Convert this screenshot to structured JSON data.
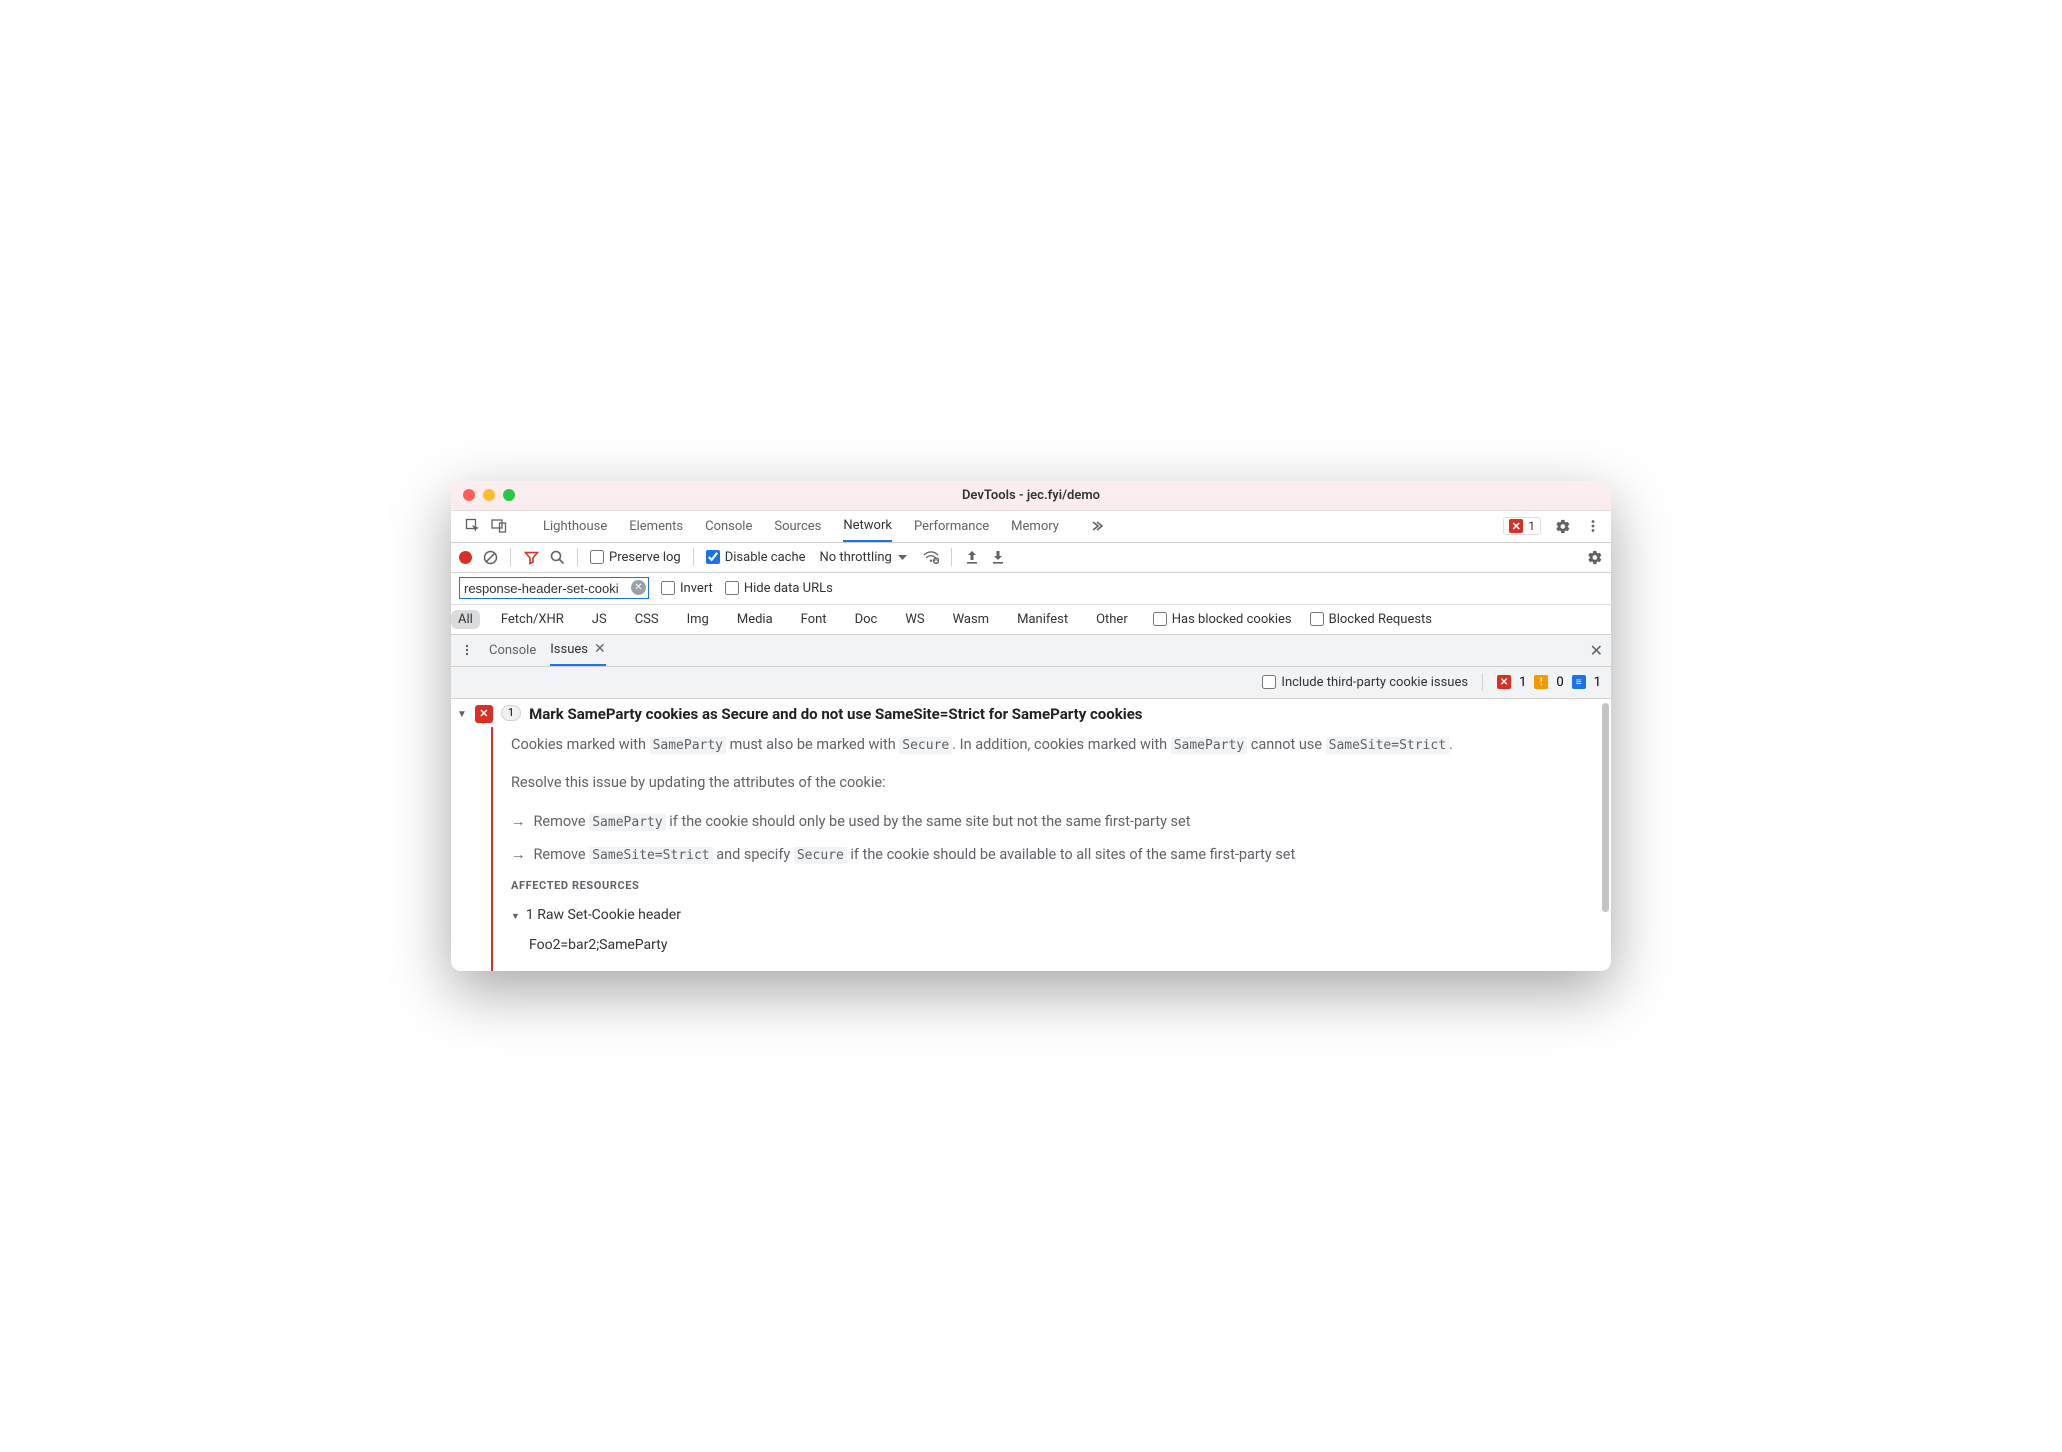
{
  "window": {
    "title": "DevTools - jec.fyi/demo"
  },
  "mainTabs": {
    "items": [
      "Lighthouse",
      "Elements",
      "Console",
      "Sources",
      "Network",
      "Performance",
      "Memory"
    ],
    "active": "Network",
    "errorCount": "1"
  },
  "toolbar": {
    "preserveLog": {
      "label": "Preserve log",
      "checked": false
    },
    "disableCache": {
      "label": "Disable cache",
      "checked": true
    },
    "throttling": "No throttling"
  },
  "filter": {
    "value": "response-header-set-cooki",
    "invert": {
      "label": "Invert",
      "checked": false
    },
    "hideDataUrls": {
      "label": "Hide data URLs",
      "checked": false
    }
  },
  "types": {
    "items": [
      "All",
      "Fetch/XHR",
      "JS",
      "CSS",
      "Img",
      "Media",
      "Font",
      "Doc",
      "WS",
      "Wasm",
      "Manifest",
      "Other"
    ],
    "active": "All",
    "blockedCookies": {
      "label": "Has blocked cookies",
      "checked": false
    },
    "blockedRequests": {
      "label": "Blocked Requests",
      "checked": false
    }
  },
  "drawer": {
    "tabs": {
      "items": [
        "Console",
        "Issues"
      ],
      "active": "Issues"
    }
  },
  "issuesHeader": {
    "includeThirdParty": {
      "label": "Include third-party cookie issues",
      "checked": false
    },
    "counts": {
      "error": "1",
      "warn": "0",
      "info": "1"
    }
  },
  "issue": {
    "count": "1",
    "title": "Mark SameParty cookies as Secure and do not use SameSite=Strict for SameParty cookies",
    "para1_a": "Cookies marked with ",
    "para1_b": " must also be marked with ",
    "para1_c": ". In addition, cookies marked with ",
    "para1_d": " cannot use ",
    "para1_e": ".",
    "code_sameparty": "SameParty",
    "code_secure": "Secure",
    "code_samesite": "SameSite=Strict",
    "para2": "Resolve this issue by updating the attributes of the cookie:",
    "bullet1_a": "Remove ",
    "bullet1_b": " if the cookie should only be used by the same site but not the same first-party set",
    "bullet2_a": "Remove ",
    "bullet2_b": " and specify ",
    "bullet2_c": " if the cookie should be available to all sites of the same first-party set",
    "affectedLabel": "AFFECTED RESOURCES",
    "rawHeaderLabel": "1 Raw Set-Cookie header",
    "cookieValue": "Foo2=bar2;SameParty"
  }
}
